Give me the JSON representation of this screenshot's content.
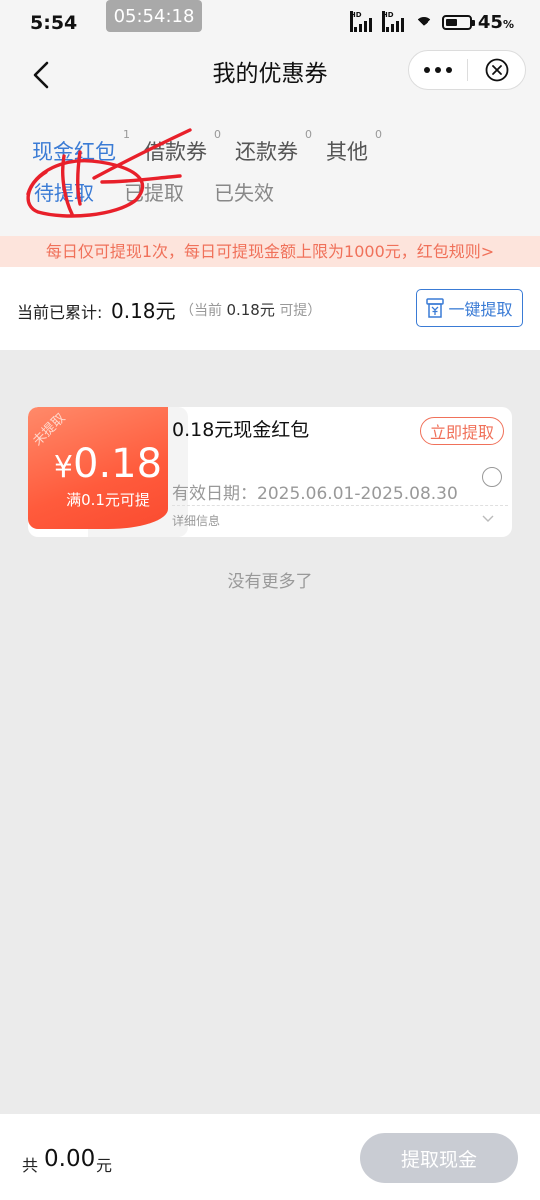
{
  "status_bar": {
    "time": "5:54",
    "clock_badge": "05:54:18",
    "signal_label": "HD",
    "battery_percent": "45",
    "battery_unit": "%"
  },
  "header": {
    "title": "我的优惠券",
    "tabs": [
      {
        "label": "现金红包",
        "count": "1"
      },
      {
        "label": "借款券",
        "count": "0"
      },
      {
        "label": "还款券",
        "count": "0"
      },
      {
        "label": "其他",
        "count": "0"
      }
    ],
    "subtabs": [
      {
        "label": "待提取"
      },
      {
        "label": "已提取"
      },
      {
        "label": "已失效"
      }
    ]
  },
  "notice": "每日仅可提现1次，每日可提现金额上限为1000元，红包规则>",
  "summary": {
    "label": "当前已累计:",
    "amount": "0.18元",
    "sub_open": "（当前",
    "sub_amount": "0.18元",
    "sub_close": "可提）",
    "withdraw_all": "一键提取"
  },
  "coupon": {
    "ribbon": "未提取",
    "currency": "¥",
    "amount": "0.18",
    "threshold": "满0.1元可提",
    "title": "0.18元现金红包",
    "claim": "立即提取",
    "validity": "有效日期：2025.06.01-2025.08.30",
    "detail": "详细信息"
  },
  "no_more": "没有更多了",
  "bottom": {
    "total_prefix": "共",
    "total_amount": "0.00",
    "total_unit": "元",
    "withdraw_button": "提取现金"
  },
  "colors": {
    "accent": "#3a7bd5",
    "coupon_red": "#ff5b3c",
    "notice_text": "#f0715a",
    "annotation_red": "#e8202a"
  }
}
